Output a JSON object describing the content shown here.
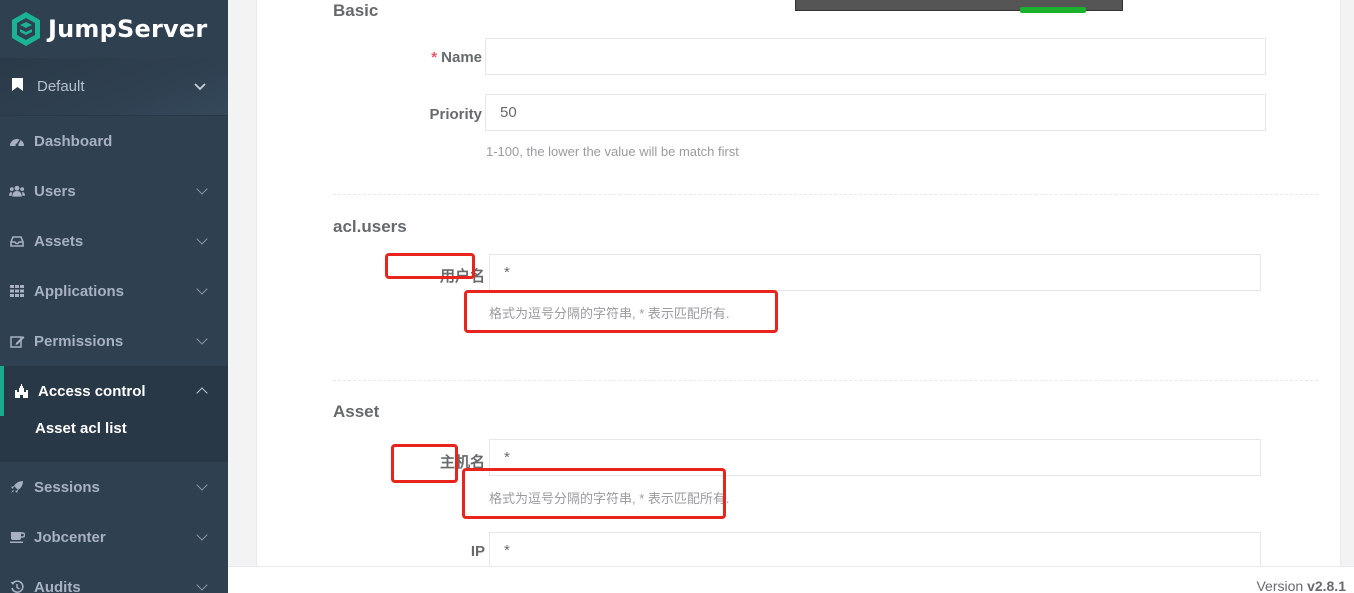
{
  "brand": {
    "name": "JumpServer",
    "logo_color": "#1ab394"
  },
  "org": {
    "label": "Default"
  },
  "sidebar": {
    "items": [
      {
        "label": "Dashboard",
        "icon": "dashboard-icon"
      },
      {
        "label": "Users",
        "icon": "users-icon"
      },
      {
        "label": "Assets",
        "icon": "inbox-icon"
      },
      {
        "label": "Applications",
        "icon": "grid-icon"
      },
      {
        "label": "Permissions",
        "icon": "edit-icon"
      },
      {
        "label": "Access control",
        "icon": "castle-icon"
      },
      {
        "label": "Sessions",
        "icon": "rocket-icon"
      },
      {
        "label": "Jobcenter",
        "icon": "coffee-icon"
      },
      {
        "label": "Audits",
        "icon": "history-icon"
      }
    ],
    "active_sub": "Asset acl list"
  },
  "form": {
    "basic": {
      "title": "Basic",
      "name_label": "Name",
      "name_value": "",
      "priority_label": "Priority",
      "priority_value": "50",
      "priority_help": "1-100, the lower the value will be match first"
    },
    "users": {
      "title": "acl.users",
      "username_label": "用户名",
      "username_value": "*",
      "username_help": "格式为逗号分隔的字符串, * 表示匹配所有."
    },
    "asset": {
      "title": "Asset",
      "hostname_label": "主机名",
      "hostname_value": "*",
      "hostname_help": "格式为逗号分隔的字符串, * 表示匹配所有.",
      "ip_label": "IP",
      "ip_value": "*"
    }
  },
  "footer": {
    "version_prefix": "Version ",
    "version": "v2.8.1"
  },
  "colors": {
    "sidebar_bg": "#2f4050",
    "accent": "#19aa8d",
    "annotation_red": "#e8241c"
  }
}
